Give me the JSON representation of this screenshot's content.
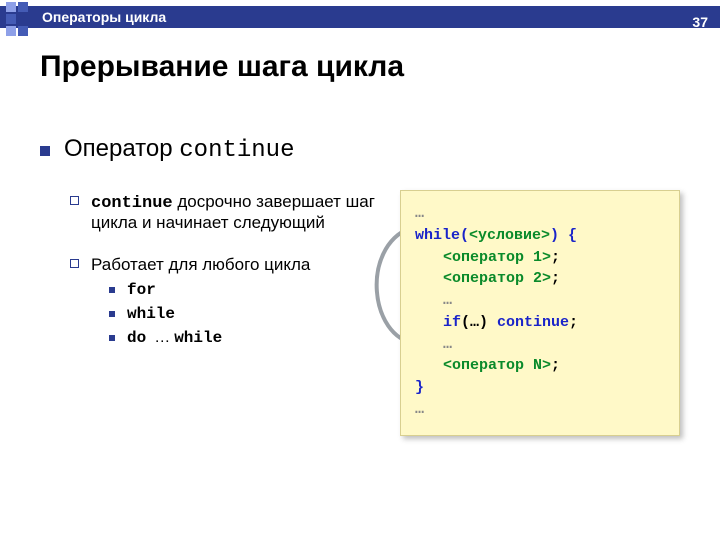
{
  "header": {
    "section": "Операторы цикла",
    "page": "37"
  },
  "title": "Прерывание шага цикла",
  "bullet1": {
    "prefix": "Оператор ",
    "kw": "continue"
  },
  "sub": {
    "item1_kw": "continue",
    "item1_rest": " досрочно завершает шаг цикла и начинает следующий",
    "item2": "Работает для любого цикла",
    "loops": {
      "for": "for",
      "while": "while",
      "do": "do",
      "dots": " … ",
      "while2": "while"
    }
  },
  "code": {
    "l1": "…",
    "l2a": "while(",
    "l2b": "<условие>",
    "l2c": ")  {",
    "l3a": "<оператор 1>",
    "l3b": ";",
    "l4a": "<оператор 2>",
    "l4b": ";",
    "l5": "…",
    "l6a": "if",
    "l6b": "(…) ",
    "l6c": "continue",
    "l6d": ";",
    "l7": "…",
    "l8a": "<оператор N>",
    "l8b": ";",
    "l9": "}",
    "l10": "…"
  }
}
